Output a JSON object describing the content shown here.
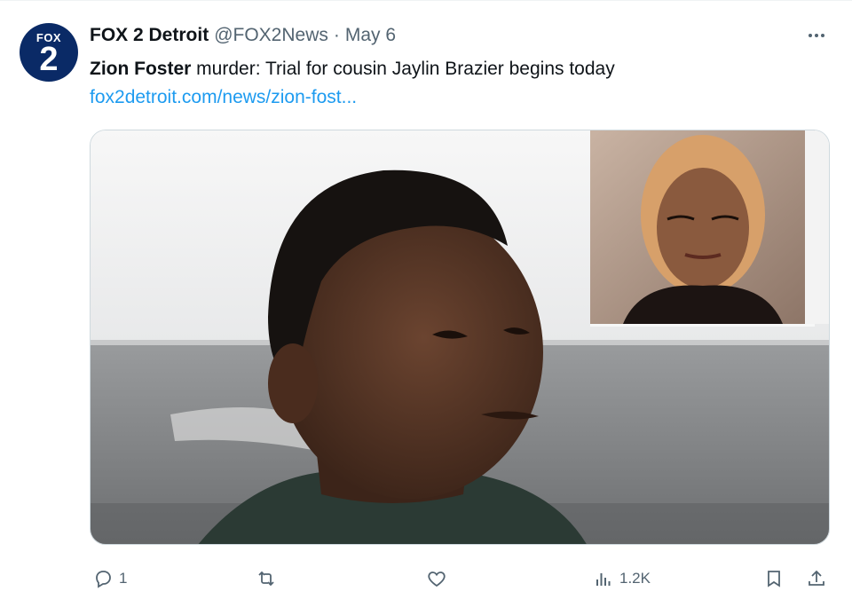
{
  "account": {
    "avatar_top": "FOX",
    "avatar_num": "2",
    "display_name": "FOX 2 Detroit",
    "handle": "@FOX2News",
    "separator": "·",
    "date": "May 6"
  },
  "tweet": {
    "text_bold": "Zion Foster",
    "text_rest": " murder: Trial for cousin Jaylin Brazier begins today",
    "link": "fox2detroit.com/news/zion-fost..."
  },
  "media": {
    "description": "Courtroom photo of a young man with inset portrait of a young woman"
  },
  "actions": {
    "replies": "1",
    "retweets": "",
    "likes": "",
    "views": "1.2K"
  },
  "colors": {
    "link": "#1d9bf0",
    "secondary_text": "#536471",
    "avatar_bg": "#0a2a66"
  },
  "icons": [
    "more-icon",
    "reply-icon",
    "retweet-icon",
    "like-icon",
    "views-icon",
    "bookmark-icon",
    "share-icon"
  ]
}
